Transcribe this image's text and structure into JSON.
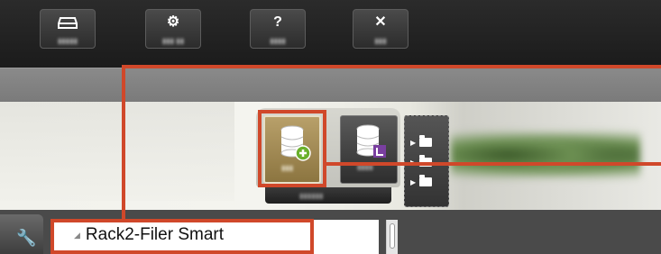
{
  "toolbar": {
    "buttons": [
      {
        "icon": "tray-icon",
        "glyph": "",
        "label": "▮▮▮▮▮"
      },
      {
        "icon": "gear-icon",
        "glyph": "⚙",
        "label": "▮▮▮ ▮▮"
      },
      {
        "icon": "help-icon",
        "glyph": "?",
        "label": "▮▮▮▮"
      },
      {
        "icon": "close-icon",
        "glyph": "✕",
        "label": "▮▮▮"
      }
    ]
  },
  "cabinet": {
    "new_label": "▮▮▮",
    "import_label": "▮▮▮▮",
    "bar_label": "▮▮▮▮▮▮"
  },
  "tree": {
    "root_label": "Rack2-Filer Smart"
  },
  "colors": {
    "callout": "#d0482a",
    "toolbar": "#1f1f1f",
    "band": "#808080"
  }
}
